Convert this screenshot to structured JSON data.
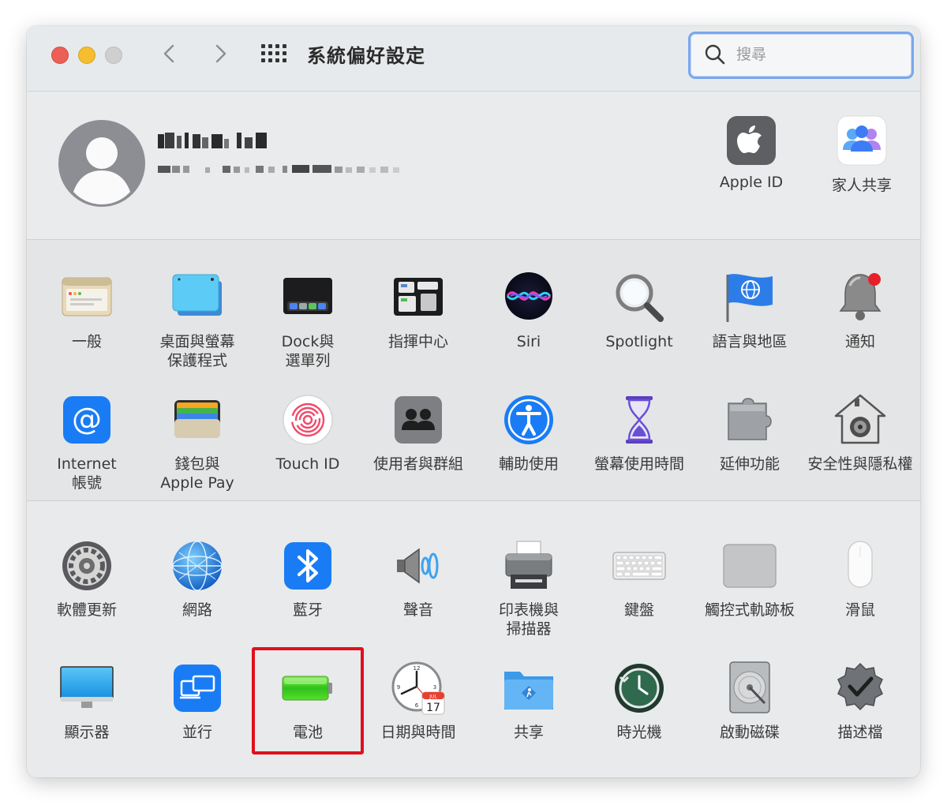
{
  "window": {
    "title": "系統偏好設定"
  },
  "search": {
    "placeholder": "搜尋",
    "value": ""
  },
  "account": {
    "items": [
      {
        "label": "Apple ID",
        "icon": "apple-logo-icon"
      },
      {
        "label": "家人共享",
        "icon": "family-sharing-icon"
      }
    ]
  },
  "section1": {
    "items": [
      {
        "label": "一般",
        "icon": "general-icon"
      },
      {
        "label": "桌面與螢幕\n保護程式",
        "icon": "desktop-screensaver-icon"
      },
      {
        "label": "Dock與\n選單列",
        "icon": "dock-icon"
      },
      {
        "label": "指揮中心",
        "icon": "mission-control-icon"
      },
      {
        "label": "Siri",
        "icon": "siri-icon"
      },
      {
        "label": "Spotlight",
        "icon": "spotlight-icon"
      },
      {
        "label": "語言與地區",
        "icon": "language-region-icon"
      },
      {
        "label": "通知",
        "icon": "notifications-icon"
      },
      {
        "label": "Internet\n帳號",
        "icon": "internet-accounts-icon"
      },
      {
        "label": "錢包與\nApple Pay",
        "icon": "wallet-icon"
      },
      {
        "label": "Touch ID",
        "icon": "touch-id-icon"
      },
      {
        "label": "使用者與群組",
        "icon": "users-groups-icon"
      },
      {
        "label": "輔助使用",
        "icon": "accessibility-icon"
      },
      {
        "label": "螢幕使用時間",
        "icon": "screen-time-icon"
      },
      {
        "label": "延伸功能",
        "icon": "extensions-icon"
      },
      {
        "label": "安全性與隱私權",
        "icon": "security-privacy-icon"
      }
    ]
  },
  "section2": {
    "items": [
      {
        "label": "軟體更新",
        "icon": "software-update-icon"
      },
      {
        "label": "網路",
        "icon": "network-icon"
      },
      {
        "label": "藍牙",
        "icon": "bluetooth-icon"
      },
      {
        "label": "聲音",
        "icon": "sound-icon"
      },
      {
        "label": "印表機與\n掃描器",
        "icon": "printer-icon"
      },
      {
        "label": "鍵盤",
        "icon": "keyboard-icon"
      },
      {
        "label": "觸控式軌跡板",
        "icon": "trackpad-icon"
      },
      {
        "label": "滑鼠",
        "icon": "mouse-icon"
      },
      {
        "label": "顯示器",
        "icon": "displays-icon"
      },
      {
        "label": "並行",
        "icon": "sidecar-icon"
      },
      {
        "label": "電池",
        "icon": "battery-icon"
      },
      {
        "label": "日期與時間",
        "icon": "date-time-icon"
      },
      {
        "label": "共享",
        "icon": "sharing-icon"
      },
      {
        "label": "時光機",
        "icon": "time-machine-icon"
      },
      {
        "label": "啟動磁碟",
        "icon": "startup-disk-icon"
      },
      {
        "label": "描述檔",
        "icon": "profiles-icon"
      }
    ],
    "highlighted": "電池"
  },
  "calendar_icon": {
    "month": "JUL",
    "day": "17"
  },
  "colors": {
    "highlight_border": "#e0101e",
    "search_focus": "#7aa7ee",
    "accent_blue": "#1a7cf5"
  }
}
